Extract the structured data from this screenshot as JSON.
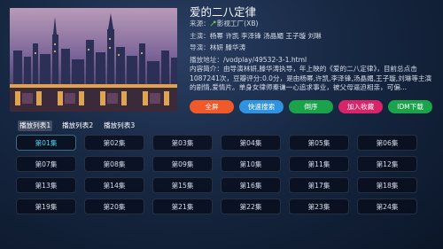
{
  "detail": {
    "title": "爱的二八定律",
    "source_key": "来源：",
    "source_val": "影视工厂(XB)",
    "cast_key": "主演：",
    "cast_val": "杨幂 许凯 李泽锋 汤晶媚 王子璇 刘琳",
    "director_key": "导演：",
    "director_val": "林妍 滕华涛",
    "play_key": "播放地址：",
    "play_val": "/vodplay/49532-3-1.html",
    "desc": "内容简介：由导演林妍,滕华涛执导，年上映的《爱的二八定律》，目前总点击1087241次，豆瓣评分:0.0分，是由杨幂,许凯,李泽锋,汤晶媚,王子璇,刘琳等主演的剧情,爱情片。单身女律师秦谦一心追求事业，被父母逼迫相亲，可偏..."
  },
  "buttons": [
    {
      "label": "全屏",
      "color": "#f05a2a"
    },
    {
      "label": "快速搜索",
      "color": "#2f93e0"
    },
    {
      "label": "倒序",
      "color": "#1aa34a"
    },
    {
      "label": "加入收藏",
      "color": "#d8256a"
    },
    {
      "label": "IDM下载",
      "color": "#1aa34a"
    }
  ],
  "tabs": [
    "播放列表1",
    "播放列表2",
    "播放列表3"
  ],
  "active_tab": 0,
  "episodes": [
    "第01集",
    "第02集",
    "第03集",
    "第04集",
    "第05集",
    "第06集",
    "第07集",
    "第08集",
    "第09集",
    "第10集",
    "第11集",
    "第12集",
    "第13集",
    "第14集",
    "第15集",
    "第16集",
    "第17集",
    "第18集",
    "第19集",
    "第20集",
    "第21集",
    "第22集",
    "第23集",
    "第24集"
  ],
  "active_episode": 0,
  "colors": {
    "accent_episode": "#4dd2e8"
  },
  "icons": {
    "source_icon": "plant-icon"
  }
}
